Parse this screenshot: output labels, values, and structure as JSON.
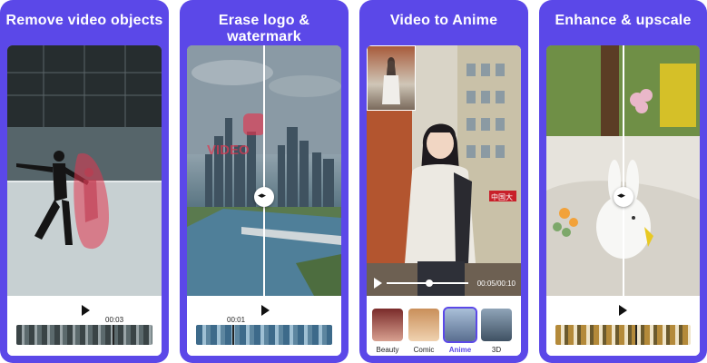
{
  "cards": [
    {
      "title": "Remove video objects",
      "time": "00:03"
    },
    {
      "title": "Erase logo & watermark",
      "time": "00:01",
      "overlay_text": "VIDEO"
    },
    {
      "title": "Video to Anime",
      "time": "00:05/00:10",
      "styles": [
        "Beauty",
        "Comic",
        "Anime",
        "3D"
      ],
      "selected_style": "Anime",
      "sign_text": "中国大"
    },
    {
      "title": "Enhance & upscale"
    }
  ],
  "colors": {
    "card_bg": "#5b48e8",
    "accent": "#5b48e8",
    "mask": "#e2364f"
  }
}
